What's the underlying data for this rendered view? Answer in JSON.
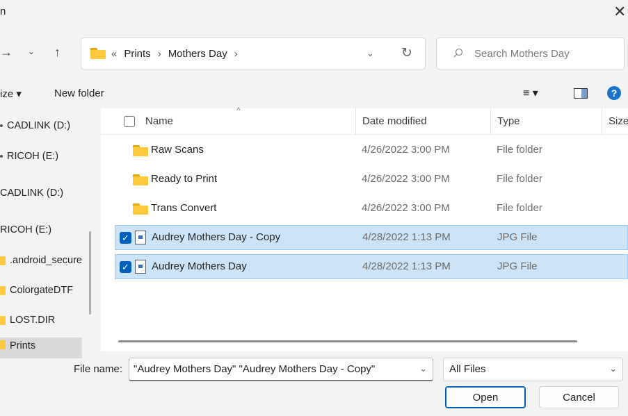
{
  "window": {
    "title": "n"
  },
  "nav": {
    "back_icon": "arrow-right-icon",
    "recent_icon": "chevron-down-icon",
    "up_icon": "arrow-up-icon"
  },
  "address": {
    "overflow": "«",
    "crumbs": [
      "Prints",
      "Mothers Day"
    ],
    "sep": "›"
  },
  "search": {
    "placeholder": "Search Mothers Day"
  },
  "toolbar": {
    "organize": "ize ▾",
    "new_folder": "New folder"
  },
  "sidebar": {
    "items": [
      {
        "label": "CADLINK (D:)",
        "icon": "drive-icon"
      },
      {
        "label": "RICOH (E:)",
        "icon": "drive-icon"
      },
      {
        "label": "CADLINK (D:)",
        "icon": "drive-icon"
      },
      {
        "label": "RICOH (E:)",
        "icon": "drive-icon"
      },
      {
        "label": ".android_secure",
        "icon": "folder-icon"
      },
      {
        "label": "ColorgateDTF",
        "icon": "folder-icon"
      },
      {
        "label": "LOST.DIR",
        "icon": "folder-icon"
      },
      {
        "label": "Prints",
        "icon": "folder-icon"
      }
    ]
  },
  "columns": {
    "name": "Name",
    "date": "Date modified",
    "type": "Type",
    "size": "Size"
  },
  "files": [
    {
      "name": "Raw Scans",
      "date": "4/26/2022 3:00 PM",
      "type": "File folder",
      "kind": "folder",
      "selected": false
    },
    {
      "name": "Ready to Print",
      "date": "4/26/2022 3:00 PM",
      "type": "File folder",
      "kind": "folder",
      "selected": false
    },
    {
      "name": "Trans Convert",
      "date": "4/26/2022 3:00 PM",
      "type": "File folder",
      "kind": "folder",
      "selected": false
    },
    {
      "name": "Audrey Mothers Day - Copy",
      "date": "4/28/2022 1:13 PM",
      "type": "JPG File",
      "kind": "jpg",
      "selected": true
    },
    {
      "name": "Audrey Mothers Day",
      "date": "4/28/2022 1:13 PM",
      "type": "JPG File",
      "kind": "jpg",
      "selected": true
    }
  ],
  "footer": {
    "file_name_label": "File name:",
    "file_name_value": "\"Audrey Mothers Day\" \"Audrey Mothers Day - Copy\"",
    "filter_value": "All Files",
    "open_label": "Open",
    "cancel_label": "Cancel"
  },
  "colors": {
    "accent": "#005fb8",
    "selection": "#cce4f7",
    "folder": "#ffc83d"
  }
}
